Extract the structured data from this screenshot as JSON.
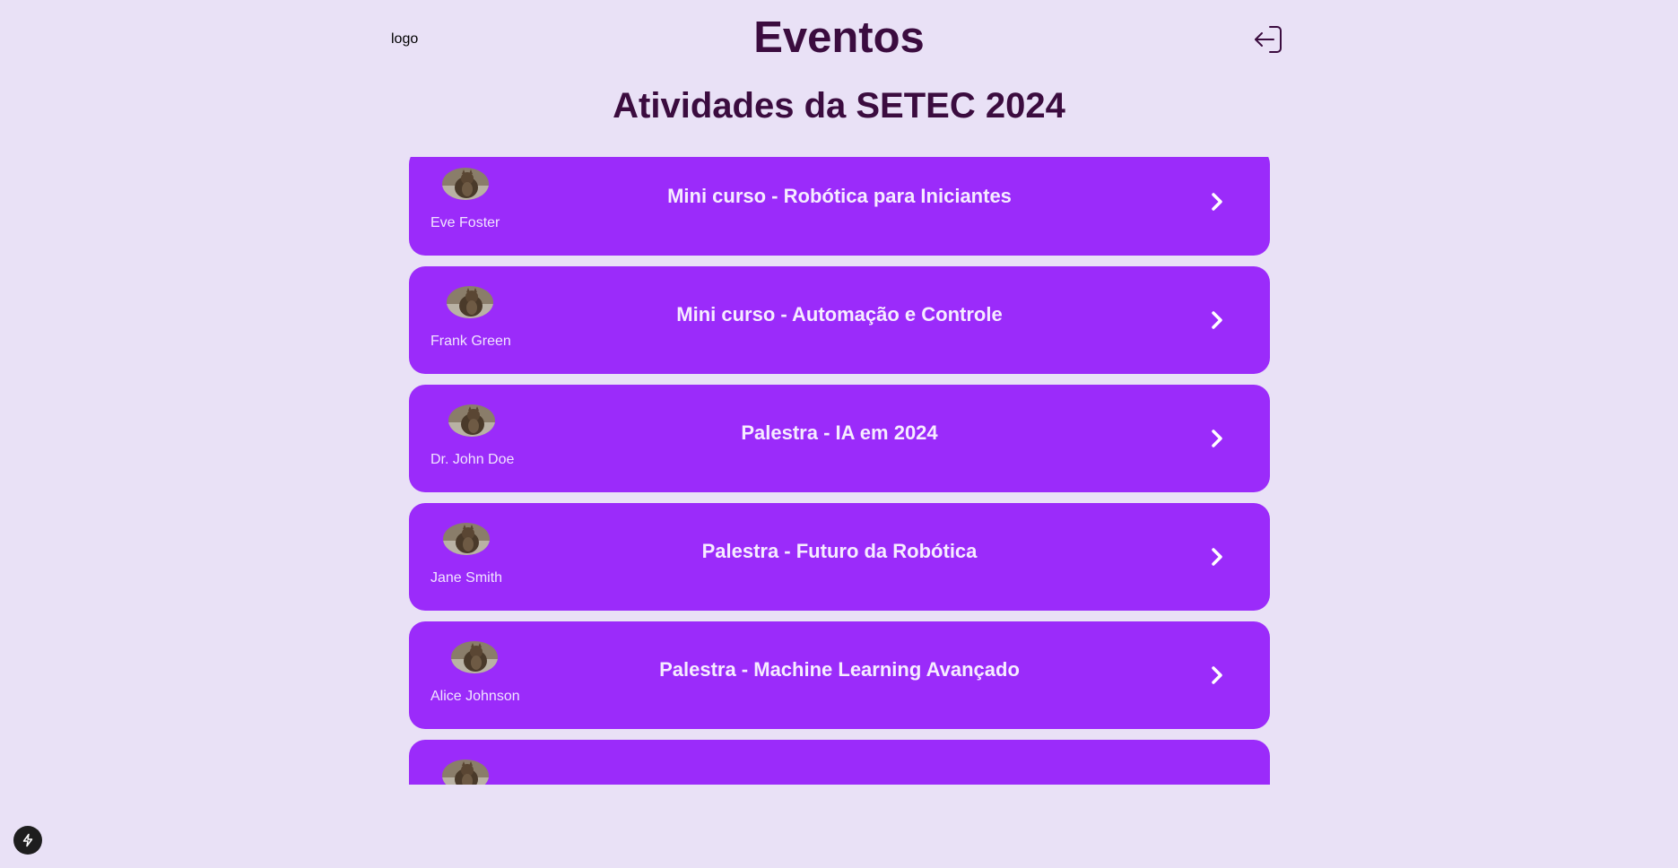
{
  "header": {
    "logo_text": "logo",
    "title": "Eventos"
  },
  "subtitle": "Atividades da SETEC 2024",
  "events": [
    {
      "speaker": "Eve Foster",
      "title": "Mini curso - Robótica para Iniciantes"
    },
    {
      "speaker": "Frank Green",
      "title": "Mini curso - Automação e Controle"
    },
    {
      "speaker": "Dr. John Doe",
      "title": "Palestra - IA em 2024"
    },
    {
      "speaker": "Jane Smith",
      "title": "Palestra - Futuro da Robótica"
    },
    {
      "speaker": "Alice Johnson",
      "title": "Palestra - Machine Learning Avançado"
    },
    {
      "speaker": "",
      "title": ""
    }
  ],
  "icons": {
    "logout": "logout-icon",
    "chevron": "chevron-right-icon",
    "avatar": "avatar-photo",
    "devtools": "lightning-bolt-icon"
  },
  "colors": {
    "background": "#e9e1f6",
    "card": "#9b2bfa",
    "title": "#3b0c3f"
  }
}
